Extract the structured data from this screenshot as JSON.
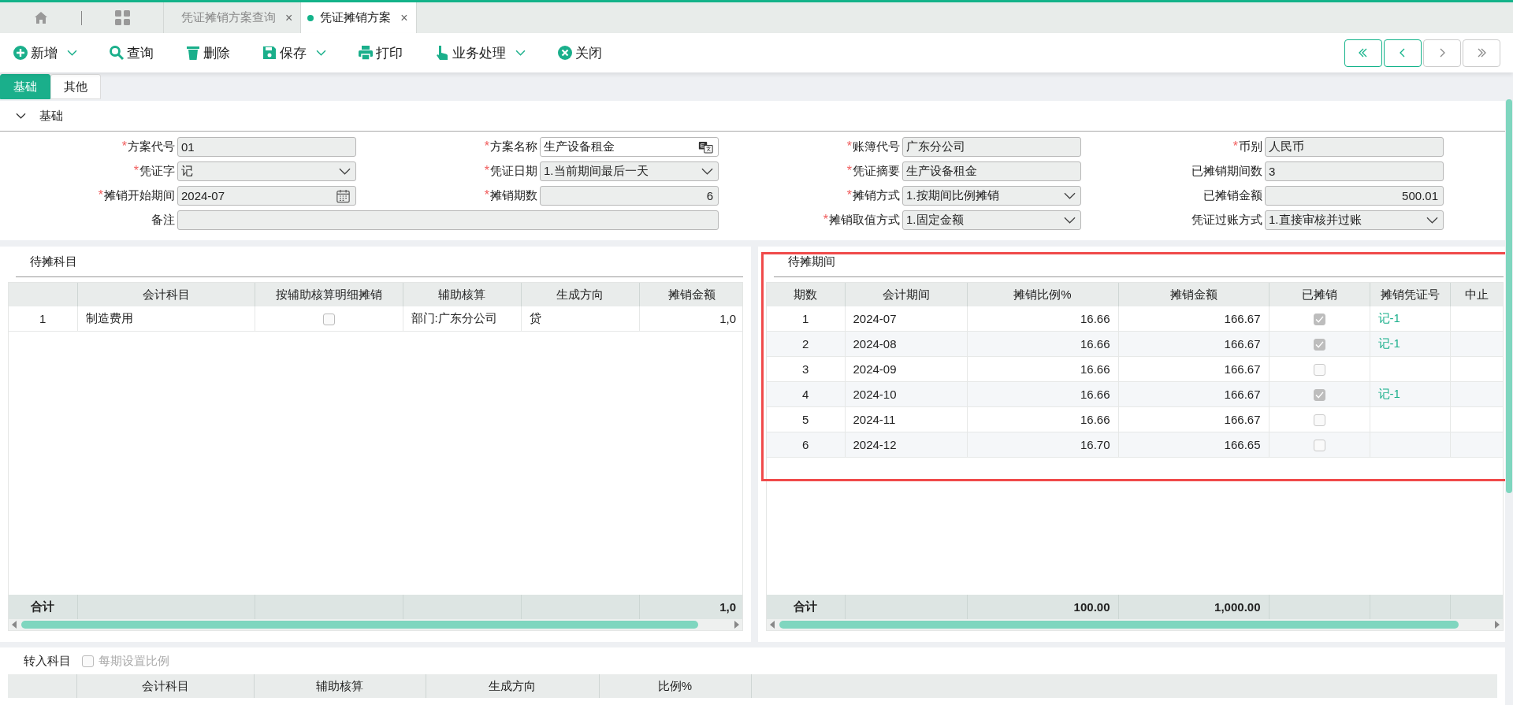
{
  "doc_tabs": [
    {
      "label": "凭证摊销方案查询",
      "close": "×",
      "selected": false
    },
    {
      "label": "凭证摊销方案",
      "close": "×",
      "selected": true
    }
  ],
  "toolbar": [
    {
      "kind": "add",
      "label": "新增",
      "dropdown": true
    },
    {
      "kind": "search",
      "label": "查询",
      "dropdown": false
    },
    {
      "kind": "delete",
      "label": "删除",
      "dropdown": false
    },
    {
      "kind": "save",
      "label": "保存",
      "dropdown": true
    },
    {
      "kind": "print",
      "label": "打印",
      "dropdown": false
    },
    {
      "kind": "process",
      "label": "业务处理",
      "dropdown": true
    },
    {
      "kind": "close",
      "label": "关闭",
      "dropdown": false
    }
  ],
  "nav_buttons": [
    {
      "kind": "first",
      "disabled": false
    },
    {
      "kind": "prev",
      "disabled": false
    },
    {
      "kind": "next",
      "disabled": true
    },
    {
      "kind": "last",
      "disabled": true
    }
  ],
  "sub_tabs": [
    {
      "label": "基础",
      "selected": true
    },
    {
      "label": "其他",
      "selected": false
    }
  ],
  "form": {
    "title": "基础",
    "expanded": true,
    "fields": [
      {
        "kind": "text",
        "label": "方案代号",
        "marker": "*",
        "readonly": true,
        "value": "01"
      },
      {
        "kind": "lang",
        "label": "方案名称",
        "marker": "*",
        "readonly": false,
        "value": "生产设备租金"
      },
      {
        "kind": "text",
        "label": "账簿代号",
        "marker": "*",
        "readonly": true,
        "value": "广东分公司"
      },
      {
        "kind": "text",
        "label": "币别",
        "marker": "*",
        "readonly": true,
        "value": "人民币"
      },
      {
        "kind": "select",
        "label": "凭证字",
        "marker": "*",
        "readonly": true,
        "value": "记"
      },
      {
        "kind": "select",
        "label": "凭证日期",
        "marker": "*",
        "readonly": true,
        "value": "1.当前期间最后一天"
      },
      {
        "kind": "text",
        "label": "凭证摘要",
        "marker": "*",
        "readonly": true,
        "value": "生产设备租金"
      },
      {
        "kind": "text",
        "label": "已摊销期间数",
        "readonly": true,
        "value": "3"
      },
      {
        "kind": "date",
        "label": "摊销开始期间",
        "marker": "*",
        "readonly": true,
        "value": "2024-07"
      },
      {
        "kind": "number",
        "label": "摊销期数",
        "marker": "*",
        "readonly": true,
        "value": "6"
      },
      {
        "kind": "select",
        "label": "摊销方式",
        "marker": "*",
        "readonly": true,
        "value": "1.按期间比例摊销"
      },
      {
        "kind": "number",
        "label": "已摊销金额",
        "readonly": true,
        "value": "500.01"
      },
      {
        "kind": "note",
        "label": "备注",
        "readonly": true
      },
      {
        "kind": "select",
        "label": "摊销取值方式",
        "marker": "*",
        "readonly": true,
        "value": "1.固定金额"
      },
      {
        "kind": "select",
        "label": "凭证过账方式",
        "readonly": true,
        "value": "1.直接审核并过账"
      }
    ]
  },
  "subjects_panel": {
    "title": "待摊科目",
    "columns": [
      "会计科目",
      "按辅助核算明细摊销",
      "辅助核算",
      "生成方向",
      "摊销金额"
    ],
    "rows": [
      {
        "index": "1",
        "account": "制造费用",
        "by_detail": false,
        "auxiliary": "部门:广东分公司",
        "direction": "贷",
        "amount": "1,0"
      }
    ],
    "total_label": "合计",
    "total_amount": "1,0"
  },
  "periods_panel": {
    "title": "待摊期间",
    "highlighted": true,
    "columns": [
      "期数",
      "会计期间",
      "摊销比例%",
      "摊销金额",
      "已摊销",
      "摊销凭证号",
      "中止"
    ],
    "rows": [
      {
        "no": "1",
        "period": "2024-07",
        "ratio": "16.66",
        "amount": "166.67",
        "amortized": true,
        "voucher": "记-1"
      },
      {
        "no": "2",
        "period": "2024-08",
        "ratio": "16.66",
        "amount": "166.67",
        "amortized": true,
        "voucher": "记-1"
      },
      {
        "no": "3",
        "period": "2024-09",
        "ratio": "16.66",
        "amount": "166.67",
        "amortized": false
      },
      {
        "no": "4",
        "period": "2024-10",
        "ratio": "16.66",
        "amount": "166.67",
        "amortized": true,
        "voucher": "记-1"
      },
      {
        "no": "5",
        "period": "2024-11",
        "ratio": "16.66",
        "amount": "166.67",
        "amortized": false
      },
      {
        "no": "6",
        "period": "2024-12",
        "ratio": "16.70",
        "amount": "166.65",
        "amortized": false
      }
    ],
    "total_label": "合计",
    "total_ratio": "100.00",
    "total_amount": "1,000.00"
  },
  "transfer_panel": {
    "title": "转入科目",
    "option": {
      "label": "每期设置比例",
      "checked": false,
      "disabled": true
    },
    "columns": [
      "会计科目",
      "辅助核算",
      "生成方向",
      "比例%"
    ]
  }
}
